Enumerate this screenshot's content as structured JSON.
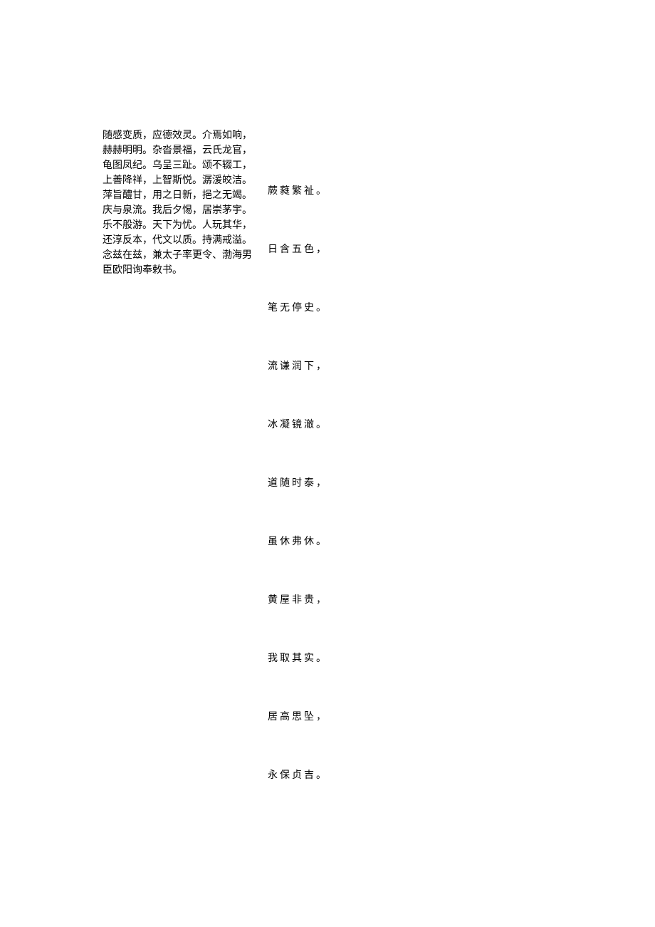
{
  "leftColumn": {
    "text": "随感变质，应德效灵。介焉如响，赫赫明明。杂沓景福，云氏龙官，龟图凤纪。乌呈三趾。颂不辍工，上善降祥，上智斯悦。潺湲皎洁。萍旨醴甘，用之日新，挹之无竭。庆与泉流。我后夕惕，居崇茅宇。乐不般游。天下为忧。人玩其华，还淳反本，代文以质。持满戒溢。念兹在兹，兼太子率更令、渤海男臣欧阳询奉敕书。"
  },
  "rightColumn": {
    "lines": [
      "蕨蕤繁祉。",
      "日含五色，",
      "笔无停史。",
      "流谦润下，",
      "冰凝镜澈。",
      "道随时泰，",
      "虽休弗休。",
      "黄屋非贵，",
      "我取其实。",
      "居高思坠，",
      "永保贞吉。"
    ]
  }
}
